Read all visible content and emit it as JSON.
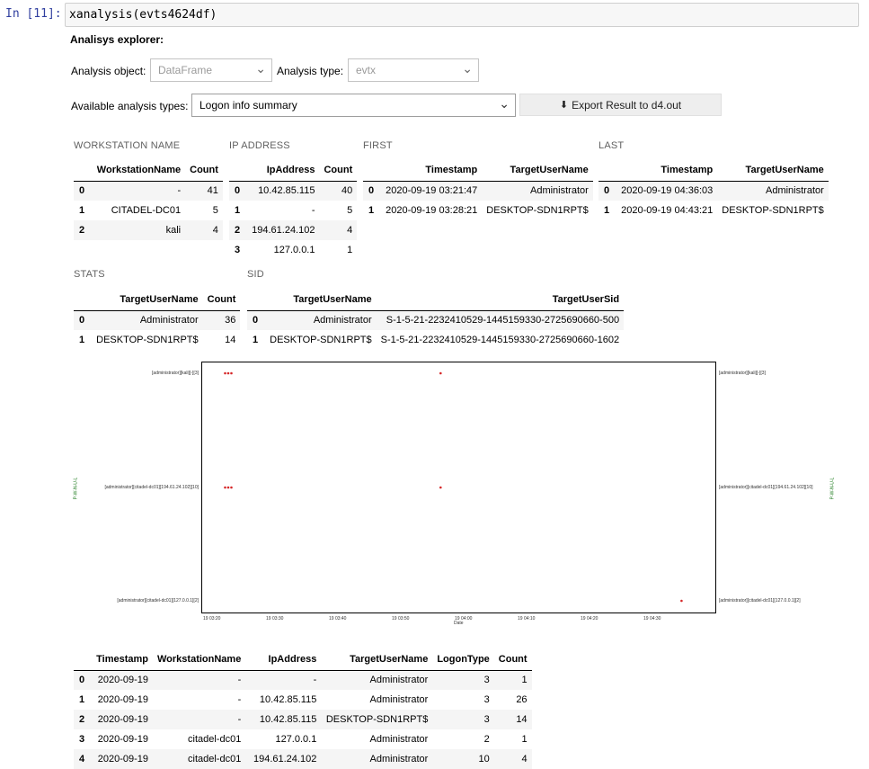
{
  "cell": {
    "prompt": "In [11]:",
    "code": "xanalysis(evts4624df)"
  },
  "explorer": {
    "title": "Analisys explorer:",
    "object_label": "Analysis object:",
    "object_value": "DataFrame",
    "type_label": "Analysis type:",
    "type_value": "evtx",
    "available_label": "Available analysis types:",
    "available_value": "Logon info summary",
    "export_label": "Export Result to d4.out"
  },
  "ws_table": {
    "title": "WORKSTATION NAME",
    "headers": [
      "",
      "WorkstationName",
      "Count"
    ],
    "rows": [
      [
        "0",
        "-",
        "41"
      ],
      [
        "1",
        "CITADEL-DC01",
        "5"
      ],
      [
        "2",
        "kali",
        "4"
      ]
    ]
  },
  "ip_table": {
    "title": "IP ADDRESS",
    "headers": [
      "",
      "IpAddress",
      "Count"
    ],
    "rows": [
      [
        "0",
        "10.42.85.115",
        "40"
      ],
      [
        "1",
        "-",
        "5"
      ],
      [
        "2",
        "194.61.24.102",
        "4"
      ],
      [
        "3",
        "127.0.0.1",
        "1"
      ]
    ]
  },
  "first_table": {
    "title": "FIRST",
    "headers": [
      "",
      "Timestamp",
      "TargetUserName"
    ],
    "rows": [
      [
        "0",
        "2020-09-19 03:21:47",
        "Administrator"
      ],
      [
        "1",
        "2020-09-19 03:28:21",
        "DESKTOP-SDN1RPT$"
      ]
    ]
  },
  "last_table": {
    "title": "LAST",
    "headers": [
      "",
      "Timestamp",
      "TargetUserName"
    ],
    "rows": [
      [
        "0",
        "2020-09-19 04:36:03",
        "Administrator"
      ],
      [
        "1",
        "2020-09-19 04:43:21",
        "DESKTOP-SDN1RPT$"
      ]
    ]
  },
  "stats_table": {
    "title": "STATS",
    "headers": [
      "",
      "TargetUserName",
      "Count"
    ],
    "rows": [
      [
        "0",
        "Administrator",
        "36"
      ],
      [
        "1",
        "DESKTOP-SDN1RPT$",
        "14"
      ]
    ]
  },
  "sid_table": {
    "title": "SID",
    "headers": [
      "",
      "TargetUserName",
      "TargetUserSid"
    ],
    "rows": [
      [
        "0",
        "Administrator",
        "S-1-5-21-2232410529-1445159330-2725690660-500"
      ],
      [
        "1",
        "DESKTOP-SDN1RPT$",
        "S-1-5-21-2232410529-1445159330-2725690660-1602"
      ]
    ]
  },
  "chart_data": {
    "type": "scatter",
    "side_title": "P-W-N-U-L",
    "xlabel": "Date",
    "x_ticks": [
      "19 03:20",
      "19 03:30",
      "19 03:40",
      "19 03:50",
      "19 04:00",
      "19 04:10",
      "19 04:20",
      "19 04:30"
    ],
    "y_categories": [
      "[administrator][kali][-][3]",
      "[administrator][citadel-dc01][194.61.24.102][10]",
      "[administrator][citadel-dc01][127.0.0.1][2]"
    ],
    "points": [
      {
        "x": "03:23:30",
        "y": 0
      },
      {
        "x": "03:24:00",
        "y": 0
      },
      {
        "x": "03:24:30",
        "y": 0
      },
      {
        "x": "03:57:45",
        "y": 0
      },
      {
        "x": "03:23:30",
        "y": 1
      },
      {
        "x": "03:24:00",
        "y": 1
      },
      {
        "x": "03:24:30",
        "y": 1
      },
      {
        "x": "03:57:45",
        "y": 1
      },
      {
        "x": "04:36:03",
        "y": 2
      }
    ],
    "marker_color": "#d62728"
  },
  "result_table": {
    "headers": [
      "",
      "Timestamp",
      "WorkstationName",
      "IpAddress",
      "TargetUserName",
      "LogonType",
      "Count"
    ],
    "rows": [
      [
        "0",
        "2020-09-19",
        "-",
        "-",
        "Administrator",
        "3",
        "1"
      ],
      [
        "1",
        "2020-09-19",
        "-",
        "10.42.85.115",
        "Administrator",
        "3",
        "26"
      ],
      [
        "2",
        "2020-09-19",
        "-",
        "10.42.85.115",
        "DESKTOP-SDN1RPT$",
        "3",
        "14"
      ],
      [
        "3",
        "2020-09-19",
        "citadel-dc01",
        "127.0.0.1",
        "Administrator",
        "2",
        "1"
      ],
      [
        "4",
        "2020-09-19",
        "citadel-dc01",
        "194.61.24.102",
        "Administrator",
        "10",
        "4"
      ]
    ]
  }
}
